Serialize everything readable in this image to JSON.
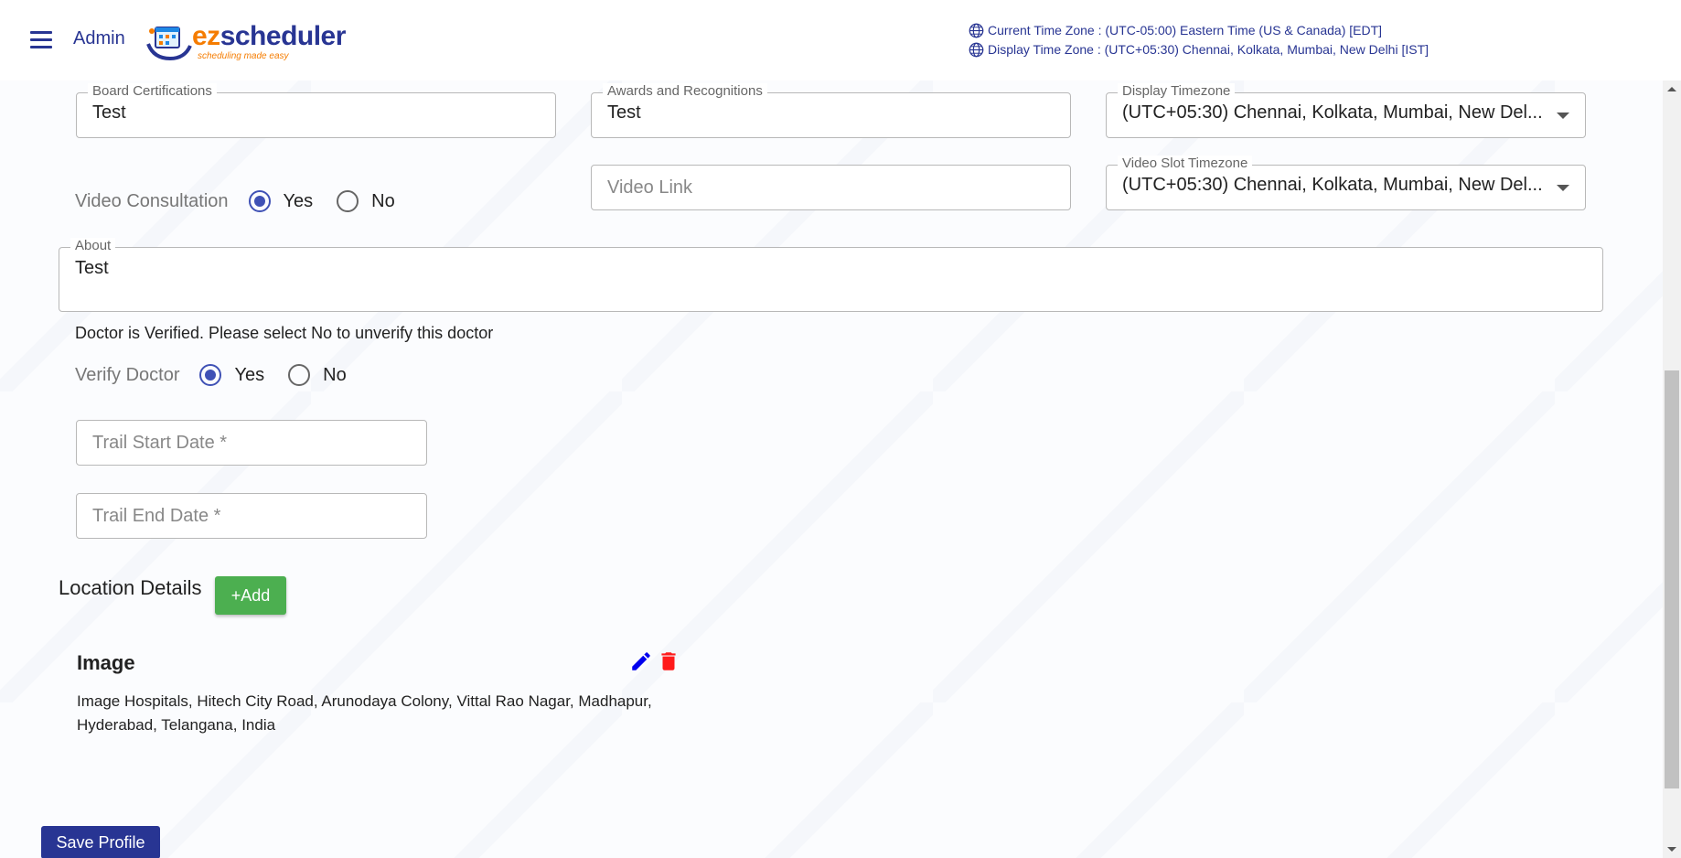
{
  "header": {
    "menu_icon": "hamburger-menu-icon",
    "role_label": "Admin",
    "logo": {
      "ez": "ez",
      "scheduler": "scheduler",
      "tagline": "scheduling made easy"
    },
    "current_tz": "Current Time Zone : (UTC-05:00) Eastern Time (US & Canada) [EDT]",
    "display_tz": "Display Time Zone : (UTC+05:30) Chennai, Kolkata, Mumbai, New Delhi [IST]",
    "tz_icon": "globe-icon"
  },
  "form": {
    "board_certifications": {
      "label": "Board Certifications",
      "value": "Test"
    },
    "awards": {
      "label": "Awards and Recognitions",
      "value": "Test"
    },
    "display_timezone": {
      "label": "Display Timezone",
      "value": "(UTC+05:30) Chennai, Kolkata, Mumbai, New Del..."
    },
    "video_consultation": {
      "label": "Video Consultation",
      "yes": "Yes",
      "no": "No",
      "selected": "Yes"
    },
    "video_link": {
      "placeholder": "Video Link"
    },
    "video_slot_timezone": {
      "label": "Video Slot Timezone",
      "value": "(UTC+05:30) Chennai, Kolkata, Mumbai, New Del..."
    },
    "about": {
      "label": "About",
      "value": "Test"
    },
    "verify_message": "Doctor is Verified. Please select No to unverify this doctor",
    "verify_doctor": {
      "label": "Verify Doctor",
      "yes": "Yes",
      "no": "No",
      "selected": "Yes"
    },
    "trail_start": {
      "placeholder": "Trail Start Date *"
    },
    "trail_end": {
      "placeholder": "Trail End Date *"
    }
  },
  "location": {
    "title": "Location Details",
    "add_label": "+Add",
    "items": [
      {
        "name": "Image",
        "address_line1": "Image Hospitals, Hitech City Road, Arunodaya Colony, Vittal Rao Nagar, Madhapur,",
        "address_line2": "Hyderabad, Telangana, India"
      }
    ]
  },
  "footer": {
    "save_label": "Save Profile"
  },
  "colors": {
    "primary": "#283593",
    "radio": "#3f51b5",
    "add_button": "#4caf50",
    "edit_icon": "#0000ee",
    "delete_icon": "#ff1a1a",
    "logo_orange": "#f57c00"
  }
}
